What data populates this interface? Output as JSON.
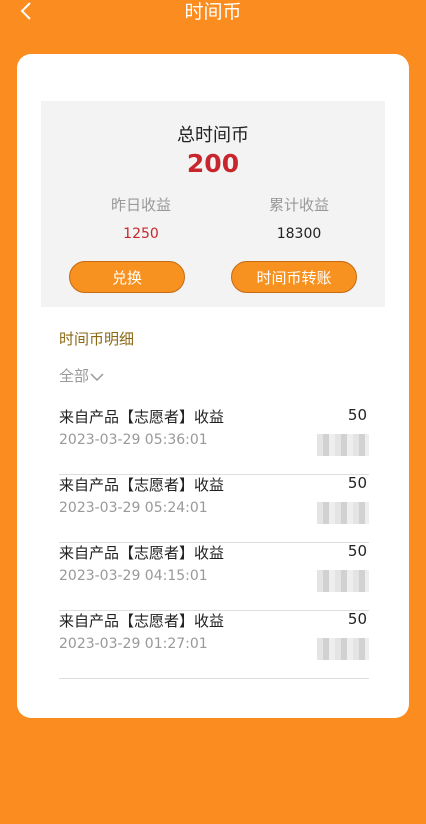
{
  "header": {
    "title": "时间币"
  },
  "summary": {
    "total_label": "总时间币",
    "total_value": "200",
    "yesterday_label": "昨日收益",
    "yesterday_value": "1250",
    "cumulative_label": "累计收益",
    "cumulative_value": "18300",
    "exchange_label": "兑换",
    "transfer_label": "时间币转账"
  },
  "details": {
    "title": "时间币明细",
    "filter_label": "全部",
    "records": [
      {
        "title": "来自产品【志愿者】收益",
        "time": "2023-03-29 05:36:01",
        "amount": "50"
      },
      {
        "title": "来自产品【志愿者】收益",
        "time": "2023-03-29 05:24:01",
        "amount": "50"
      },
      {
        "title": "来自产品【志愿者】收益",
        "time": "2023-03-29 04:15:01",
        "amount": "50"
      },
      {
        "title": "来自产品【志愿者】收益",
        "time": "2023-03-29 01:27:01",
        "amount": "50"
      }
    ]
  },
  "colors": {
    "background": "#fb8c1f",
    "accent_red": "#c8262c",
    "button": "#f7911f"
  },
  "icons": {
    "back": "chevron-left-icon",
    "filter": "chevron-down-icon"
  }
}
